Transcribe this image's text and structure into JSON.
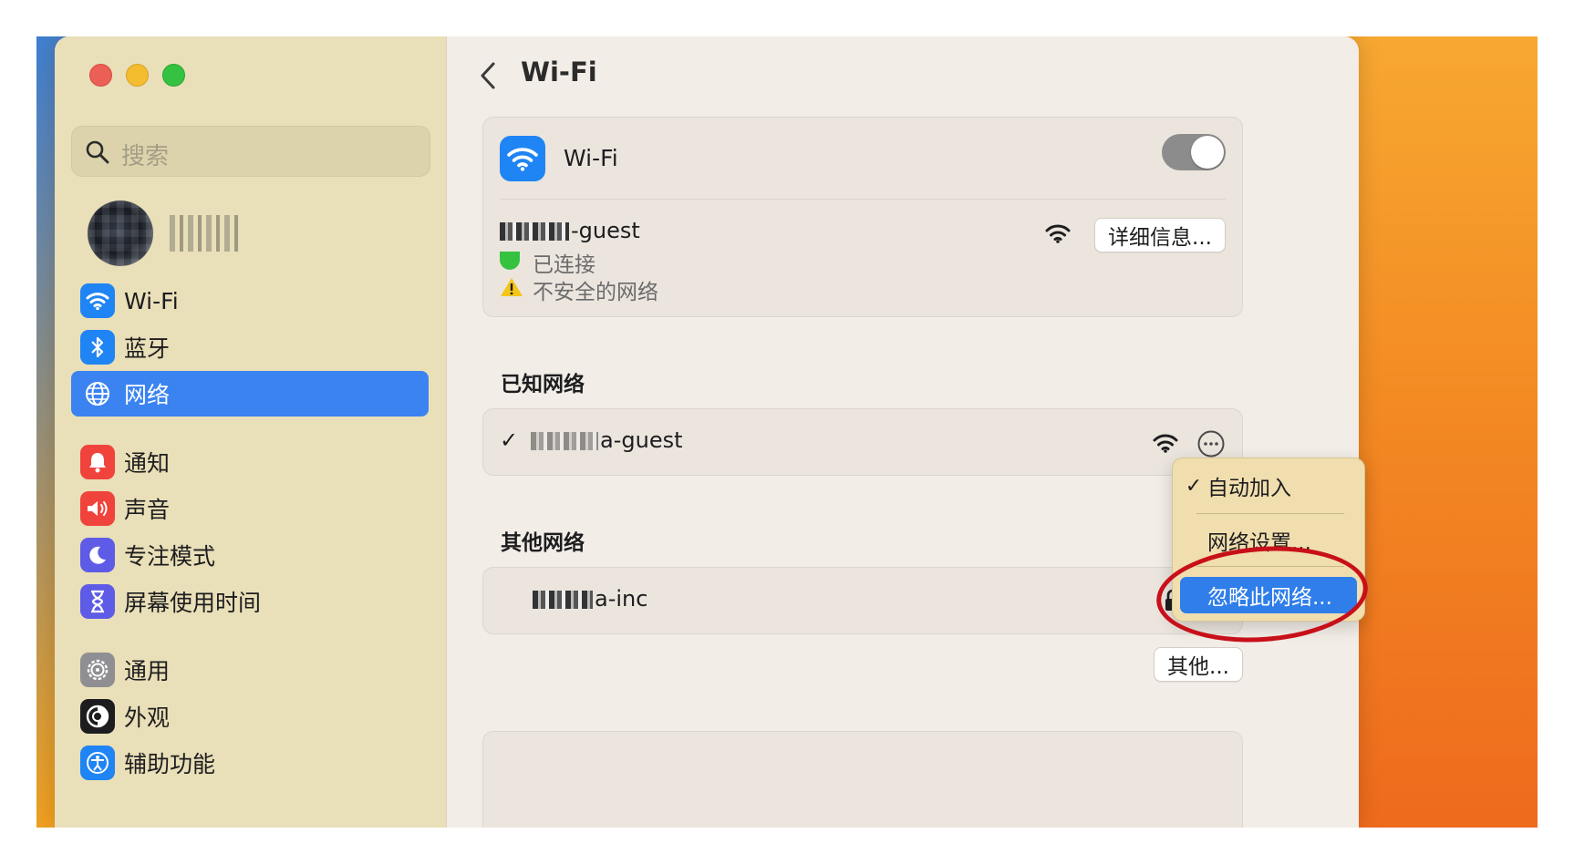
{
  "window": {
    "title": "Wi-Fi"
  },
  "sidebar": {
    "search_placeholder": "搜索",
    "items": [
      {
        "label": "Wi-Fi",
        "icon": "wifi-icon",
        "color": "#1f84f4",
        "selected": false
      },
      {
        "label": "蓝牙",
        "icon": "bluetooth-icon",
        "color": "#1f84f4",
        "selected": false
      },
      {
        "label": "网络",
        "icon": "globe-icon",
        "color": "#3a83f1",
        "selected": true
      },
      {
        "label": "通知",
        "icon": "bell-icon",
        "color": "#f0433c",
        "selected": false
      },
      {
        "label": "声音",
        "icon": "speaker-icon",
        "color": "#f0433c",
        "selected": false
      },
      {
        "label": "专注模式",
        "icon": "moon-icon",
        "color": "#5e5ce6",
        "selected": false
      },
      {
        "label": "屏幕使用时间",
        "icon": "hourglass-icon",
        "color": "#5e5ce6",
        "selected": false
      },
      {
        "label": "通用",
        "icon": "gear-icon",
        "color": "#8e8e93",
        "selected": false
      },
      {
        "label": "外观",
        "icon": "appearance-icon",
        "color": "#1d1d1f",
        "selected": false
      },
      {
        "label": "辅助功能",
        "icon": "accessibility-icon",
        "color": "#1f84f4",
        "selected": false
      }
    ]
  },
  "wifi": {
    "label": "Wi-Fi",
    "enabled": true,
    "current_network": {
      "name_suffix": "-guest",
      "status_connected": "已连接",
      "status_insecure": "不安全的网络",
      "details_button": "详细信息..."
    }
  },
  "known": {
    "heading": "已知网络",
    "networks": [
      {
        "name_suffix": "a-guest",
        "checked": true
      }
    ]
  },
  "other": {
    "heading": "其他网络",
    "networks": [
      {
        "name_suffix": "a-inc",
        "locked": true
      }
    ],
    "other_button": "其他..."
  },
  "context_menu": {
    "items": [
      {
        "label": "自动加入",
        "checked": true
      },
      {
        "label": "网络设置..."
      },
      {
        "label": "忽略此网络...",
        "highlighted": true
      }
    ]
  },
  "colors": {
    "accent": "#3a83f1",
    "annotation": "#c8101a"
  }
}
